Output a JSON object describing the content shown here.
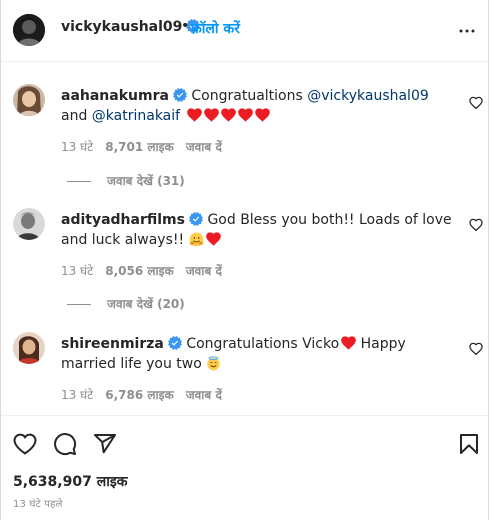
{
  "header": {
    "username": "vickykaushal09",
    "separator": "•",
    "follow_label": "फ़ॉलो करें"
  },
  "comments": [
    {
      "username": "aahanakumra",
      "text_before": "Congratualtions ",
      "mention1": "@vickykaushal09",
      "text_mid": " and ",
      "mention2": "@katrinakaif",
      "emojis": [
        "red-heart",
        "red-heart",
        "red-heart",
        "red-heart",
        "red-heart"
      ],
      "time": "13 घंटे",
      "likes": "8,701 लाइक",
      "reply": "जवाब दें",
      "view_replies": "जवाब देखें (31)"
    },
    {
      "username": "adityadharfilms",
      "text": "God Bless you both!! Loads of love and luck always!!",
      "emojis": [
        "hugging-face",
        "red-heart"
      ],
      "time": "13 घंटे",
      "likes": "8,056 लाइक",
      "reply": "जवाब दें",
      "view_replies": "जवाब देखें (20)"
    },
    {
      "username": "shireenmirza",
      "text_before": "Congratulations Vicko",
      "text_after": " Happy married life you two",
      "emojis": [
        "red-heart",
        "smiling-face-with-halo"
      ],
      "time": "13 घंटे",
      "likes": "6,786 लाइक",
      "reply": "जवाब दें"
    }
  ],
  "actions": {
    "icons": [
      "heart-outline-icon",
      "comment-icon",
      "share-icon",
      "bookmark-icon"
    ],
    "likes_total": "5,638,907 लाइक",
    "time_ago": "13 घंटे पहले"
  },
  "colors": {
    "link": "#0095f6",
    "mention": "#00376b",
    "muted": "#8e8e8e",
    "heart": "#ed1c24"
  }
}
